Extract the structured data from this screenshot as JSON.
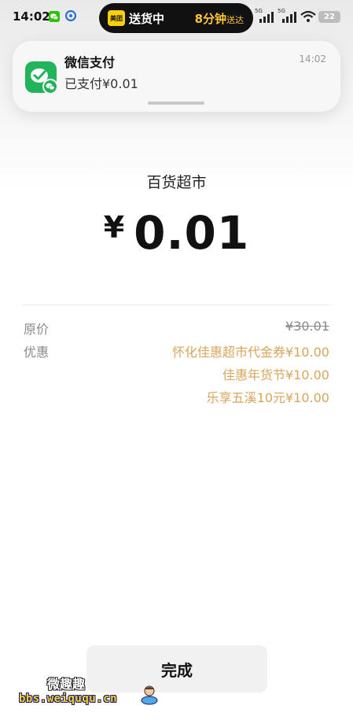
{
  "status_bar": {
    "time": "14:02",
    "live_activity": {
      "app_logo_text": "美团",
      "status": "送货中",
      "eta_value": "8分钟",
      "eta_suffix": "送达"
    },
    "network_label_1": "5G",
    "network_label_2": "5G",
    "battery": "22"
  },
  "notification": {
    "app_name": "微信支付",
    "message": "已支付¥0.01",
    "time": "14:02"
  },
  "payment": {
    "merchant": "百货超市",
    "currency_symbol": "¥",
    "amount": "0.01"
  },
  "details": {
    "original_label": "原价",
    "original_price": "¥30.01",
    "discount_label": "优惠",
    "discounts": [
      "怀化佳惠超市代金券¥10.00",
      "佳惠年货节¥10.00",
      "乐享五溪10元¥10.00"
    ]
  },
  "actions": {
    "done_label": "完成"
  },
  "watermark": {
    "title": "微趣趣",
    "url": "bbs.weiququ.cn"
  },
  "colors": {
    "wechat_green": "#22b45a",
    "discount_gold": "#d9a55b",
    "island_accent": "#ffc43a"
  }
}
